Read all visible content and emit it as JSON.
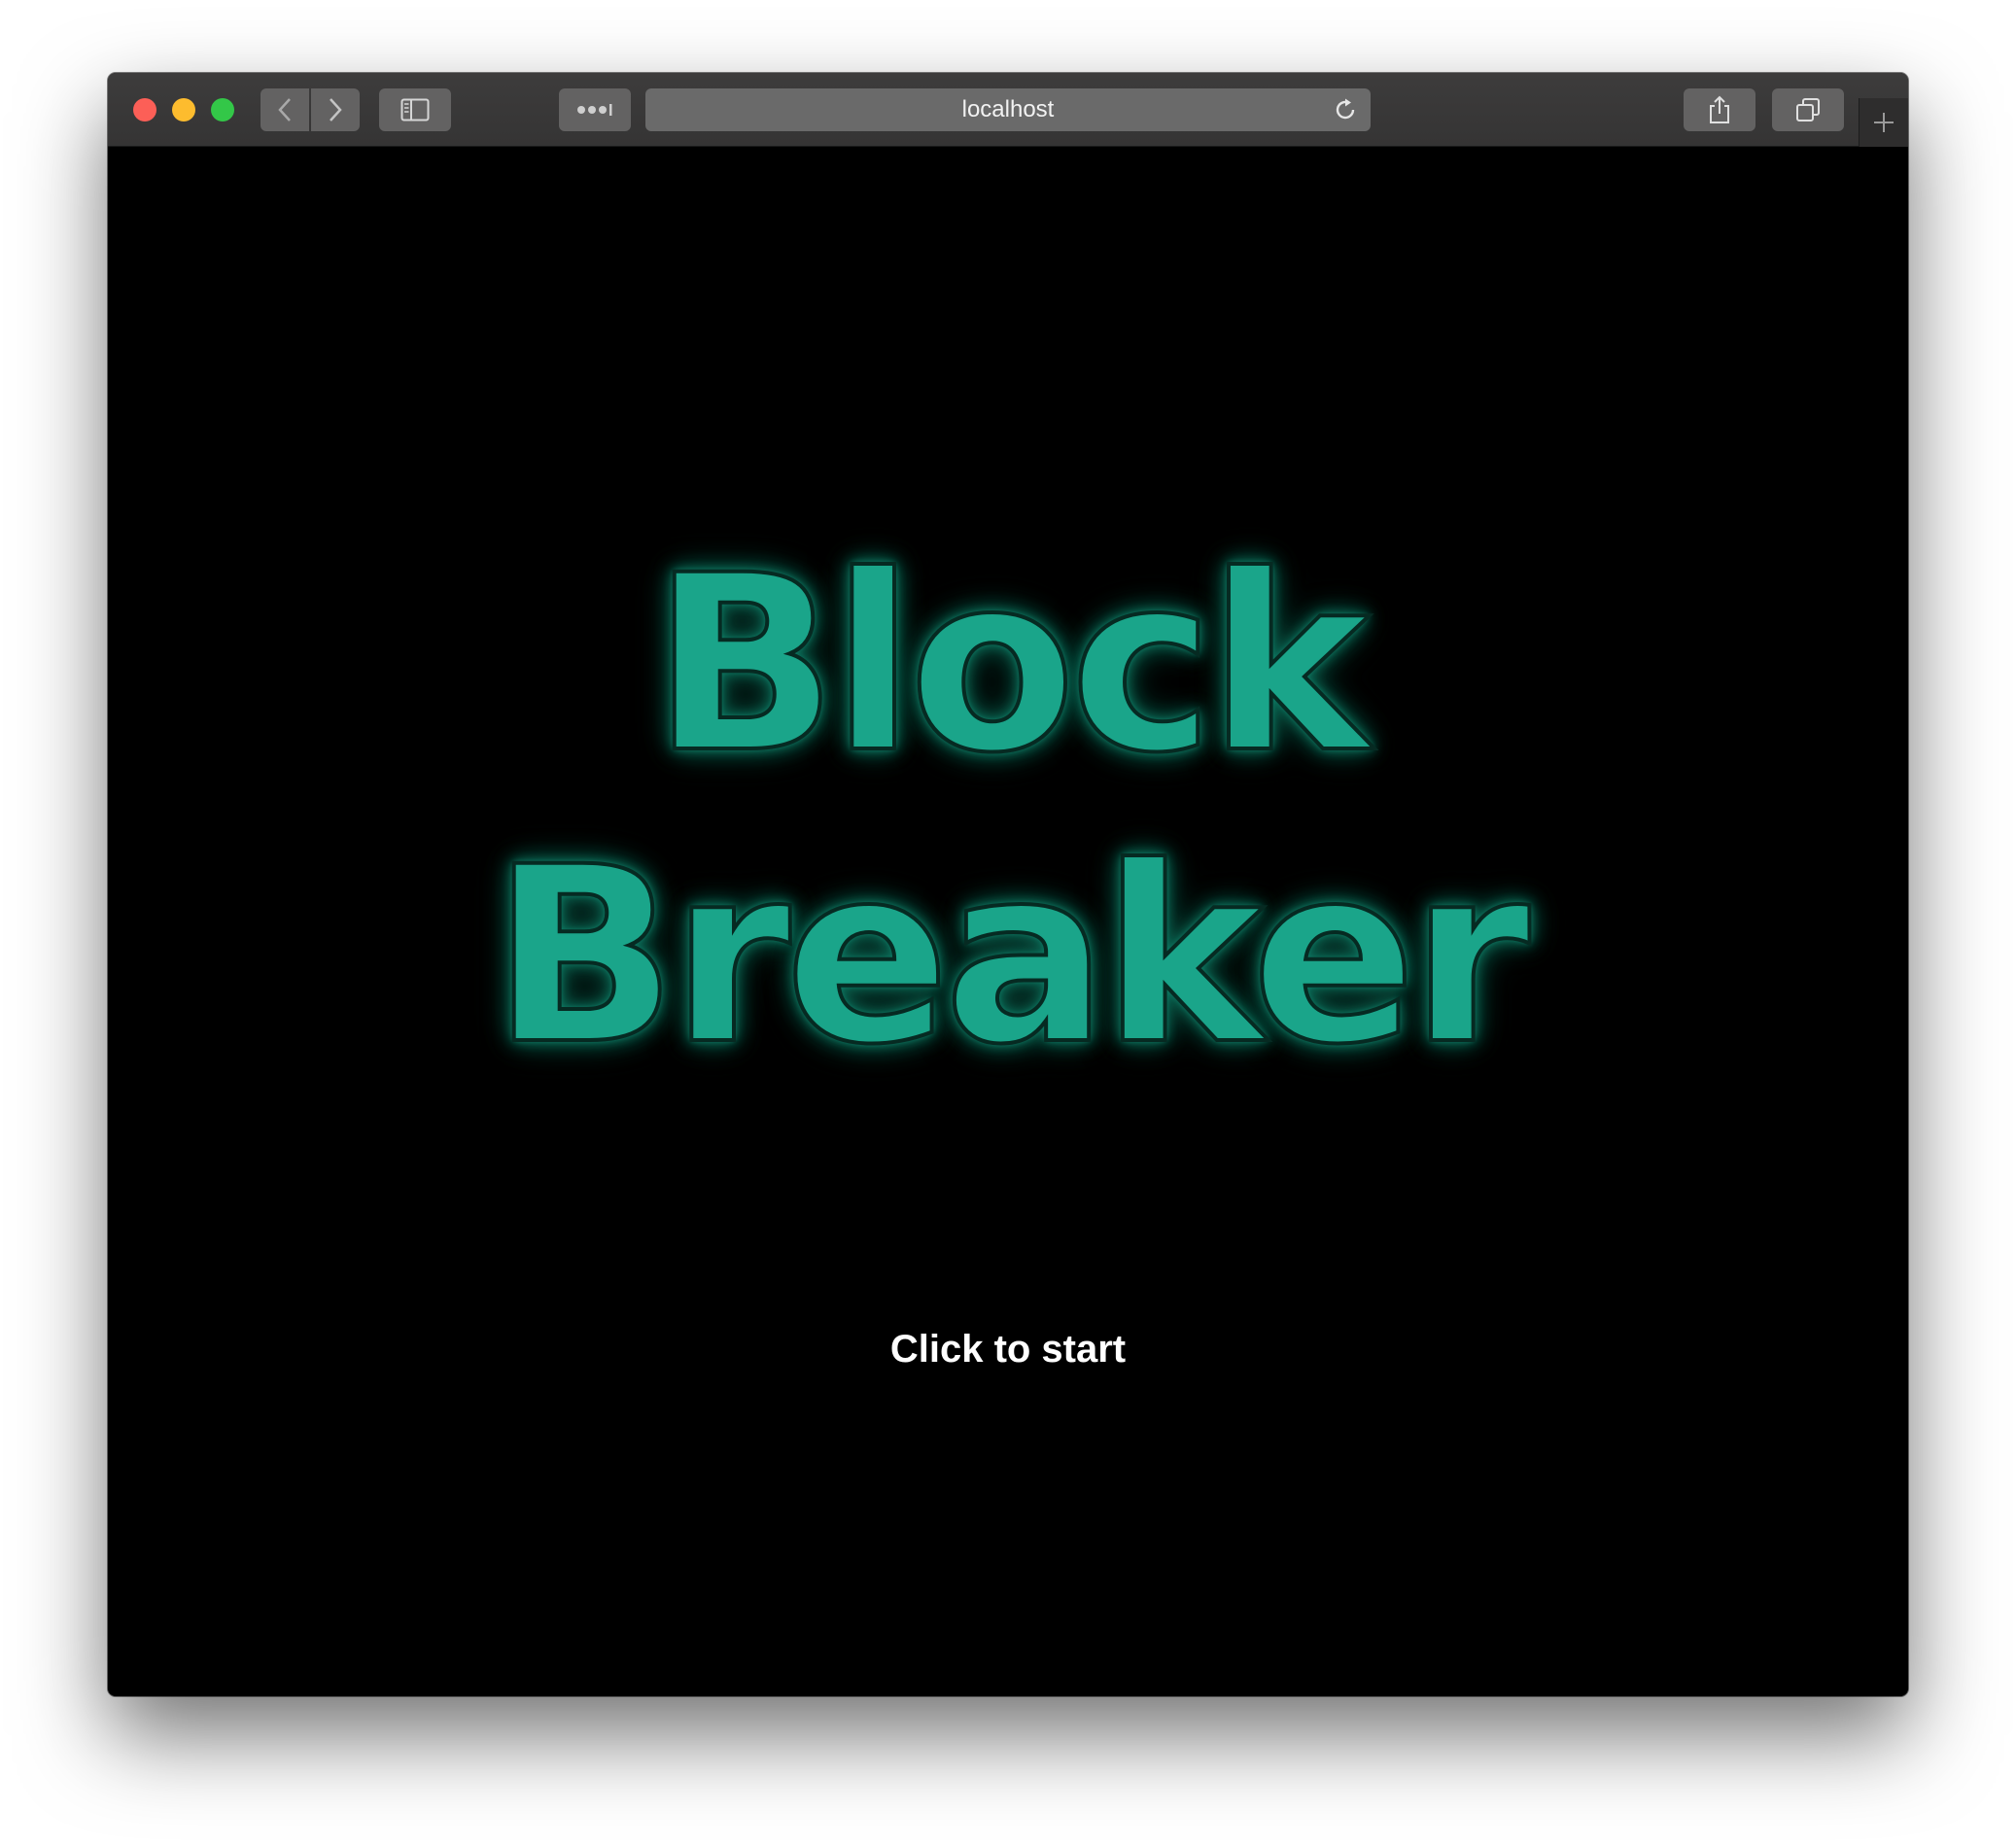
{
  "browser": {
    "url": "localhost",
    "toolbar_icons": [
      "back-chevron-icon",
      "forward-chevron-icon",
      "sidebar-icon",
      "more-dots-icon",
      "reload-icon",
      "share-icon",
      "tabs-icon",
      "plus-icon"
    ]
  },
  "game": {
    "title_line_1": "Block",
    "title_line_2": "Breaker",
    "start_prompt": "Click to start",
    "title_color": "#1aa58a",
    "background_color": "#000000"
  }
}
